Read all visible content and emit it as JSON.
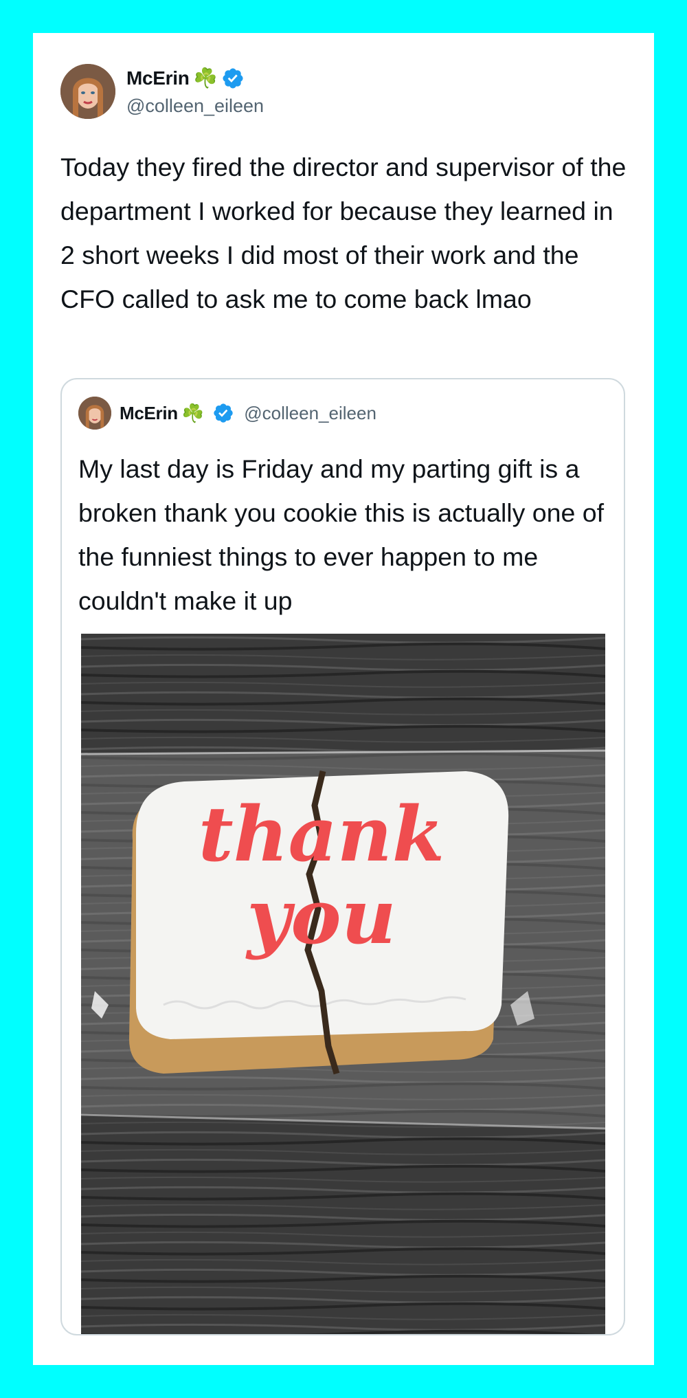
{
  "tweet": {
    "author_name": "McErin",
    "author_emoji": "☘️",
    "handle": "@colleen_eileen",
    "text": "Today they fired the director and supervisor of the department I worked for because they learned in 2 short weeks I did most of their work and the CFO called to ask me to come back lmao"
  },
  "quoted_tweet": {
    "author_name": "McErin",
    "author_emoji": "☘️",
    "handle": "@colleen_eileen",
    "text": "My last day is Friday and my parting gift is a broken thank you cookie this is actually one of the funniest things to ever happen to me couldn't make it up",
    "photo_icing_text": "thank you"
  },
  "colors": {
    "background": "#00ffff",
    "card": "#ffffff",
    "verified_badge": "#1d9bf0",
    "icing": "#ef4d4f"
  }
}
